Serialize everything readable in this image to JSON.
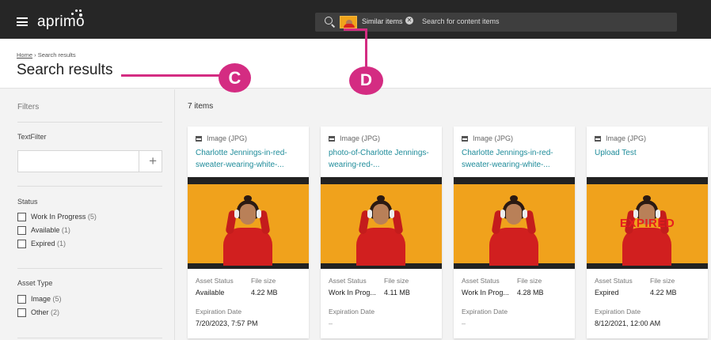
{
  "app": {
    "logo": "aprimo"
  },
  "search": {
    "chip_label": "Similar items",
    "placeholder": "Search for content items"
  },
  "breadcrumb": {
    "home": "Home",
    "separator": "›",
    "current": "Search results"
  },
  "page_title": "Search results",
  "callouts": {
    "c": "C",
    "d": "D"
  },
  "filters": {
    "title": "Filters",
    "text_filter": {
      "label": "TextFilter",
      "value": "",
      "add_label": "+"
    },
    "status": {
      "label": "Status",
      "options": [
        {
          "label": "Work In Progress",
          "count": "(5)"
        },
        {
          "label": "Available",
          "count": "(1)"
        },
        {
          "label": "Expired",
          "count": "(1)"
        }
      ]
    },
    "asset_type": {
      "label": "Asset Type",
      "options": [
        {
          "label": "Image",
          "count": "(5)"
        },
        {
          "label": "Other",
          "count": "(2)"
        }
      ]
    }
  },
  "results": {
    "count_label": "7 items",
    "cards": [
      {
        "type": "Image (JPG)",
        "name": "Charlotte Jennings-in-red-sweater-wearing-white-...",
        "status_label": "Asset Status",
        "status": "Available",
        "size_label": "File size",
        "size": "4.22 MB",
        "exp_label": "Expiration Date",
        "exp": "7/20/2023, 7:57 PM",
        "overlay": ""
      },
      {
        "type": "Image (JPG)",
        "name": "photo-of-Charlotte Jennings-wearing-red-...",
        "status_label": "Asset Status",
        "status": "Work In Prog...",
        "size_label": "File size",
        "size": "4.11 MB",
        "exp_label": "Expiration Date",
        "exp": "–",
        "overlay": ""
      },
      {
        "type": "Image (JPG)",
        "name": "Charlotte Jennings-in-red-sweater-wearing-white-...",
        "status_label": "Asset Status",
        "status": "Work In Prog...",
        "size_label": "File size",
        "size": "4.28 MB",
        "exp_label": "Expiration Date",
        "exp": "–",
        "overlay": ""
      },
      {
        "type": "Image (JPG)",
        "name": "Upload Test",
        "status_label": "Asset Status",
        "status": "Expired",
        "size_label": "File size",
        "size": "4.22 MB",
        "exp_label": "Expiration Date",
        "exp": "8/12/2021, 12:00 AM",
        "overlay": "EXPIRED"
      }
    ]
  }
}
